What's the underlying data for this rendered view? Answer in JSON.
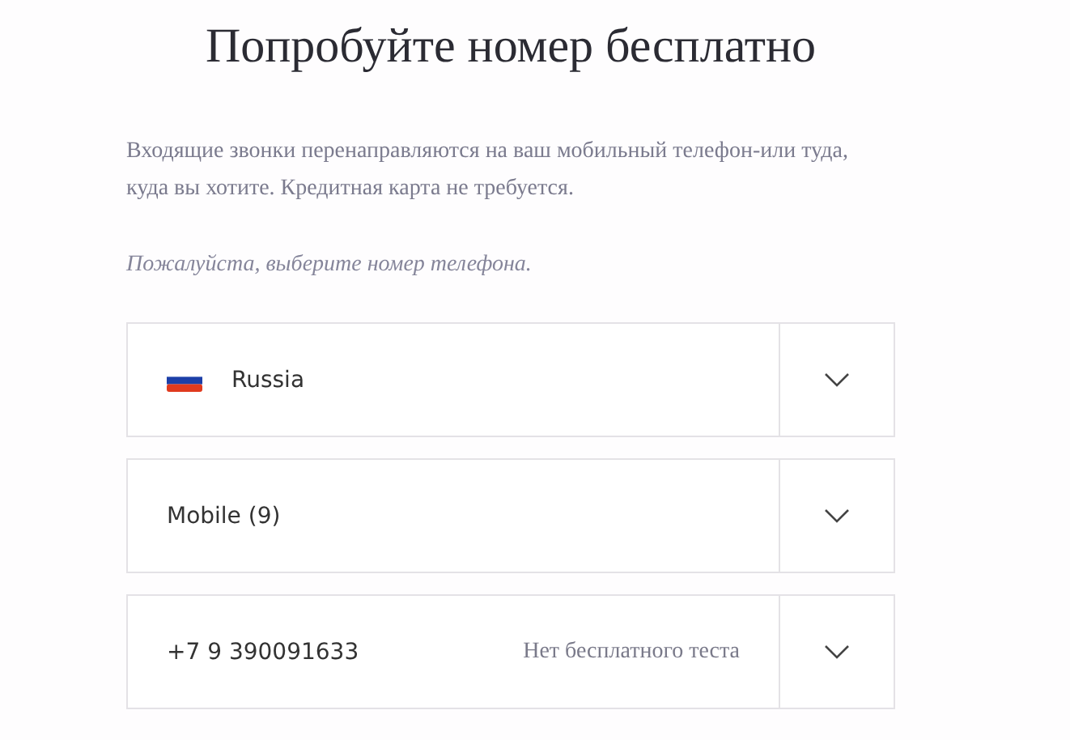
{
  "title": "Попробуйте номер бесплатно",
  "description": "Входящие звонки перенаправляются на ваш мобильный телефон-или туда, куда вы хотите. Кредитная карта не требуется.",
  "prompt": "Пожалуйста, выберите номер телефона.",
  "selects": [
    {
      "kind": "country",
      "value": "Russia"
    },
    {
      "kind": "plain",
      "value": "Mobile (9)"
    },
    {
      "kind": "number",
      "value": "+7 9 390091633",
      "note": "Нет бесплатного теста"
    }
  ]
}
